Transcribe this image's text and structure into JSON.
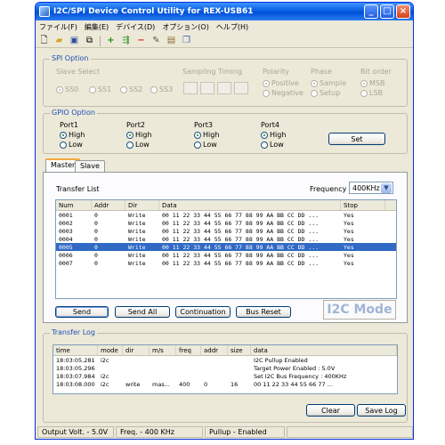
{
  "window": {
    "title": "I2C/SPI Device Control Utility for REX-USB61"
  },
  "titlebar_buttons": [
    "_",
    "□",
    "×"
  ],
  "menu": [
    "ファイル(F)",
    "編集(E)",
    "デバイス(D)",
    "オプション(O)",
    "ヘルプ(H)"
  ],
  "toolbar_icons": [
    "new-icon",
    "open-icon",
    "save-icon",
    "copy-icon",
    "add-icon",
    "insert-icon",
    "delete-icon",
    "erase-icon",
    "paste-icon",
    "duplicate-icon"
  ],
  "spi": {
    "title": "SPI Option",
    "slave_select": "Slave Select",
    "slaves": [
      "SS0",
      "SS1",
      "SS2",
      "SS3"
    ],
    "sampling_timing": "Sampling Timing",
    "polarity": "Polarity",
    "polarity_options": [
      "Positive",
      "Negative"
    ],
    "phase": "Phase",
    "phase_options": [
      "Sample",
      "Setup"
    ],
    "bit_order": "Bit order",
    "bit_order_options": [
      "MSB",
      "LSB"
    ]
  },
  "gpio": {
    "title": "GPIO Option",
    "ports": [
      {
        "name": "Port1",
        "high": "High",
        "low": "Low"
      },
      {
        "name": "Port2",
        "high": "High",
        "low": "Low"
      },
      {
        "name": "Port3",
        "high": "High",
        "low": "Low"
      },
      {
        "name": "Port4",
        "high": "High",
        "low": "Low"
      }
    ],
    "set_label": "Set"
  },
  "tabs": [
    "Master",
    "Slave"
  ],
  "transfer": {
    "list_label": "Transfer List",
    "frequency_label": "Frequency",
    "frequency_value": "400KHz",
    "columns": [
      "Num",
      "Addr",
      "Dir",
      "Data",
      "Stop"
    ],
    "rows": [
      {
        "num": "0001",
        "addr": "0",
        "dir": "Write",
        "data": "00 11 22 33 44 55 66 77 88 99 AA BB CC DD ...",
        "stop": "Yes"
      },
      {
        "num": "0002",
        "addr": "0",
        "dir": "Write",
        "data": "00 11 22 33 44 55 66 77 88 99 AA BB CC DD ...",
        "stop": "Yes"
      },
      {
        "num": "0003",
        "addr": "0",
        "dir": "Write",
        "data": "00 11 22 33 44 55 66 77 88 99 AA BB CC DD ...",
        "stop": "Yes"
      },
      {
        "num": "0004",
        "addr": "0",
        "dir": "Write",
        "data": "00 11 22 33 44 55 66 77 88 99 AA BB CC DD ...",
        "stop": "Yes"
      },
      {
        "num": "0005",
        "addr": "0",
        "dir": "Write",
        "data": "00 11 22 33 44 55 66 77 88 99 AA BB CC DD ...",
        "stop": "Yes"
      },
      {
        "num": "0006",
        "addr": "0",
        "dir": "Write",
        "data": "00 11 22 33 44 55 66 77 88 99 AA BB CC DD ...",
        "stop": "Yes"
      },
      {
        "num": "0007",
        "addr": "0",
        "dir": "Write",
        "data": "00 11 22 33 44 55 66 77 88 99 AA BB CC DD ...",
        "stop": "Yes"
      }
    ],
    "selected_row": "0005",
    "buttons": [
      "Send",
      "Send All",
      "Continuation",
      "Bus Reset"
    ],
    "mode": "I2C Mode"
  },
  "log": {
    "title": "Transfer Log",
    "columns": [
      "time",
      "mode",
      "dir",
      "m/s",
      "freq",
      "addr",
      "size",
      "data"
    ],
    "rows": [
      {
        "time": "18:03:05.281",
        "mode": "i2c",
        "dir": "",
        "ms": "",
        "freq": "",
        "addr": "",
        "size": "",
        "data": "I2C Pullup Enabled"
      },
      {
        "time": "18:03:05.296",
        "mode": "",
        "dir": "",
        "ms": "",
        "freq": "",
        "addr": "",
        "size": "",
        "data": "Target Power Enabled : 5.0V"
      },
      {
        "time": "18:03:07.984",
        "mode": "i2c",
        "dir": "",
        "ms": "",
        "freq": "",
        "addr": "",
        "size": "",
        "data": "Set I2C Bus Frequency : 400KHz"
      },
      {
        "time": "18:03:08.000",
        "mode": "i2c",
        "dir": "write",
        "ms": "mas...",
        "freq": "400",
        "addr": "0",
        "size": "16",
        "data": "00 11 22 33 44 55 66 77 ..."
      }
    ],
    "clear_label": "Clear",
    "save_label": "Save Log"
  },
  "status": {
    "volt": "Output Volt. - 5.0V",
    "freq": "Freq. - 400 KHz",
    "pullup": "Pullup - Enabled"
  },
  "colors": {
    "accent": "#0a5fe0",
    "selection": "#316ac5",
    "mode_text": "#9fb5d6"
  }
}
